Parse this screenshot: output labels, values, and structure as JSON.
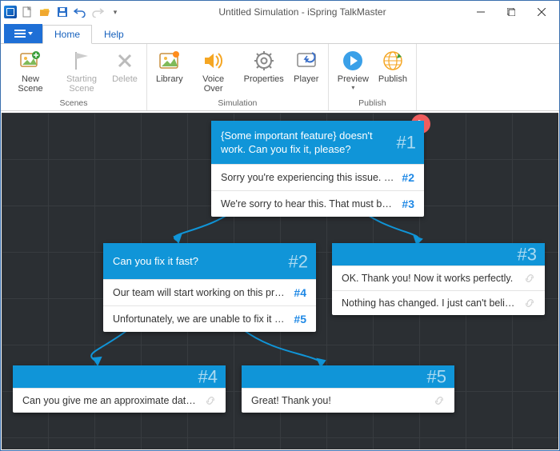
{
  "title": "Untitled Simulation - iSpring TalkMaster",
  "tabs": {
    "home": "Home",
    "help": "Help"
  },
  "ribbon": {
    "scenes": {
      "label": "Scenes",
      "newScene": "New Scene",
      "startingScene": "Starting Scene",
      "delete": "Delete"
    },
    "simulation": {
      "label": "Simulation",
      "library": "Library",
      "voiceOver": "Voice Over",
      "properties": "Properties",
      "player": "Player"
    },
    "publish": {
      "label": "Publish",
      "preview": "Preview",
      "publishBtn": "Publish"
    }
  },
  "nodes": {
    "n1": {
      "num": "#1",
      "text": "{Some important feature} doesn't work. Can you fix it, please?",
      "rows": [
        {
          "text": "Sorry you're experiencing this issue. We ...",
          "num": "#2"
        },
        {
          "text": "We're sorry to hear this. That must be v...",
          "num": "#3"
        }
      ]
    },
    "n2": {
      "num": "#2",
      "text": "Can you fix it fast?",
      "rows": [
        {
          "text": "Our team will start working on this pro...",
          "num": "#4"
        },
        {
          "text": "Unfortunately, we are unable to fix it rig...",
          "num": "#5"
        }
      ]
    },
    "n3": {
      "num": "#3",
      "text": "",
      "rows": [
        {
          "text": "OK. Thank you! Now it works perfectly."
        },
        {
          "text": "Nothing has changed. I just can't believ..."
        }
      ]
    },
    "n4": {
      "num": "#4",
      "text": "",
      "rows": [
        {
          "text": "Can you give me an approximate date ..."
        }
      ]
    },
    "n5": {
      "num": "#5",
      "text": "",
      "rows": [
        {
          "text": "Great! Thank you!"
        }
      ]
    }
  }
}
